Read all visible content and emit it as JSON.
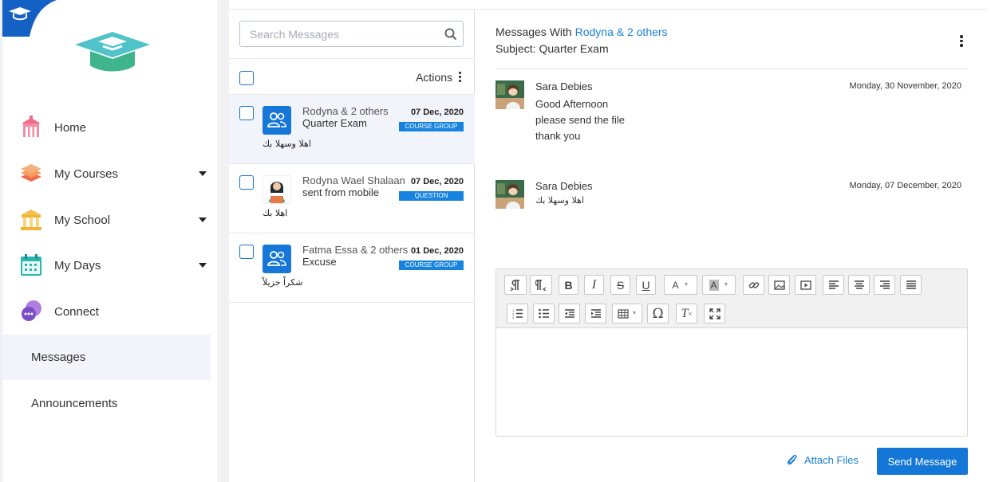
{
  "sidebar": {
    "nav": [
      {
        "label": "Home",
        "icon": "school-building-icon",
        "has_caret": false
      },
      {
        "label": "My Courses",
        "icon": "books-stack-icon",
        "has_caret": true
      },
      {
        "label": "My School",
        "icon": "school-pillars-icon",
        "has_caret": true
      },
      {
        "label": "My Days",
        "icon": "calendar-icon",
        "has_caret": true
      },
      {
        "label": "Connect",
        "icon": "chat-bubbles-icon",
        "has_caret": false
      }
    ],
    "sub": [
      {
        "label": "Messages",
        "active": true
      },
      {
        "label": "Announcements",
        "active": false
      }
    ]
  },
  "list": {
    "search_placeholder": "Search Messages",
    "actions_label": "Actions",
    "threads": [
      {
        "name": "Rodyna & 2 others",
        "subject": "Quarter Exam",
        "date": "07 Dec, 2020",
        "badge": "COURSE GROUP",
        "preview": "اهلا وسهلا بك",
        "avatar": "group-icon",
        "selected": true
      },
      {
        "name": "Rodyna Wael Shalaan",
        "subject": "sent from mobile",
        "date": "07 Dec, 2020",
        "badge": "QUESTION",
        "preview": "اهلا بك",
        "avatar": "student-avatar",
        "selected": false
      },
      {
        "name": "Fatma Essa & 2 others",
        "subject": "Excuse",
        "date": "01 Dec, 2020",
        "badge": "COURSE GROUP",
        "preview": "شكراً جزيلاً",
        "avatar": "group-icon",
        "selected": false
      }
    ]
  },
  "detail": {
    "with_prefix": "Messages With",
    "with_link": "Rodyna & 2 others",
    "subject_line": "Subject: Quarter Exam",
    "messages": [
      {
        "sender": "Sara Debies",
        "date": "Monday, 30 November, 2020",
        "lines": [
          "Good Afternoon",
          "please send the file",
          "thank you"
        ]
      },
      {
        "sender": "Sara Debies",
        "date": "Monday, 07 December, 2020",
        "lines": [
          "اهلا وسهلا بك"
        ]
      }
    ],
    "attach_label": "Attach Files",
    "send_label": "Send Message"
  },
  "colors": {
    "accent": "#1476d6",
    "link": "#1a7fd6",
    "badge": "#1683e0",
    "selected_row": "#f2f4fb"
  }
}
